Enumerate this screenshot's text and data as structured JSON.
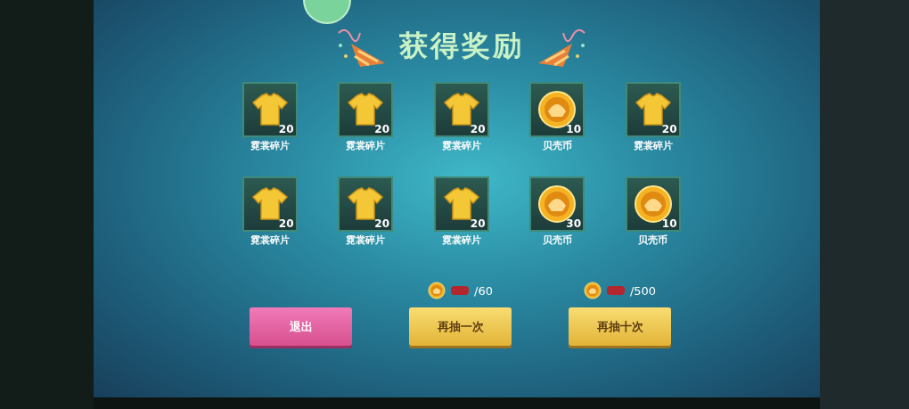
{
  "title": "获得奖励",
  "rewards": [
    {
      "kind": "shirt",
      "count": "20",
      "label": "霓裳碎片"
    },
    {
      "kind": "shirt",
      "count": "20",
      "label": "霓裳碎片"
    },
    {
      "kind": "shirt",
      "count": "20",
      "label": "霓裳碎片"
    },
    {
      "kind": "coin",
      "count": "10",
      "label": "贝壳币"
    },
    {
      "kind": "shirt",
      "count": "20",
      "label": "霓裳碎片"
    },
    {
      "kind": "shirt",
      "count": "20",
      "label": "霓裳碎片"
    },
    {
      "kind": "shirt",
      "count": "20",
      "label": "霓裳碎片"
    },
    {
      "kind": "shirt",
      "count": "20",
      "label": "霓裳碎片"
    },
    {
      "kind": "coin",
      "count": "30",
      "label": "贝壳币"
    },
    {
      "kind": "coin",
      "count": "10",
      "label": "贝壳币"
    }
  ],
  "actions": [
    {
      "kind": "exit",
      "label": "退出"
    },
    {
      "kind": "draw",
      "label": "再抽一次",
      "cost": "/60"
    },
    {
      "kind": "draw",
      "label": "再抽十次",
      "cost": "/500"
    }
  ]
}
